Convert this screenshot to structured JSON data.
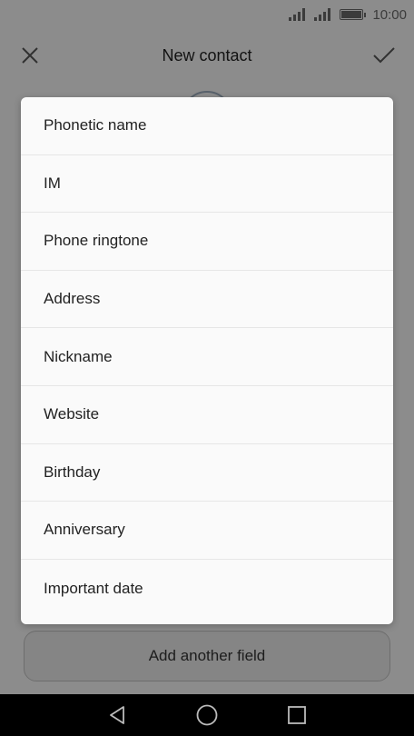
{
  "status_bar": {
    "time": "10:00"
  },
  "app_bar": {
    "title": "New contact"
  },
  "add_field_button": {
    "label": "Add another field"
  },
  "dialog": {
    "options": [
      {
        "label": "Phonetic name"
      },
      {
        "label": "IM"
      },
      {
        "label": "Phone ringtone"
      },
      {
        "label": "Address"
      },
      {
        "label": "Nickname"
      },
      {
        "label": "Website"
      },
      {
        "label": "Birthday"
      },
      {
        "label": "Anniversary"
      },
      {
        "label": "Important date"
      }
    ]
  },
  "icons": {
    "signal_1": "signal-icon",
    "signal_2": "signal-icon",
    "battery": "battery-icon",
    "close": "close-icon",
    "confirm": "checkmark-icon",
    "back": "back-triangle-icon",
    "home": "home-circle-icon",
    "recents": "recents-square-icon"
  },
  "colors": {
    "scrim": "#000000",
    "dialog_bg": "#fafafa",
    "navbar_bg": "#000000"
  }
}
